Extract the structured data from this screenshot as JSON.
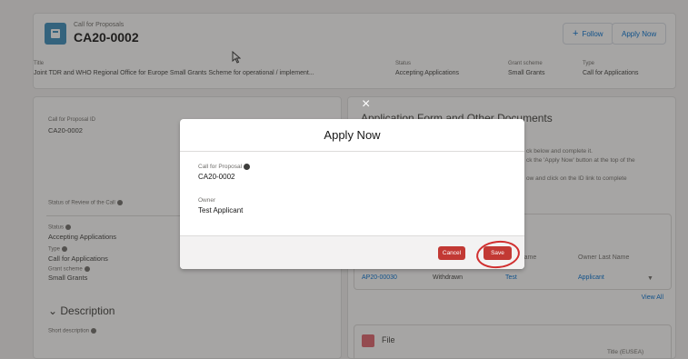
{
  "header": {
    "record_type": "Call for Proposals",
    "record_name": "CA20-0002",
    "follow_label": "Follow",
    "apply_label": "Apply Now",
    "fields": [
      {
        "label": "Title",
        "value": "Joint TDR and WHO Regional Office for Europe Small Grants Scheme for operational / implement..."
      },
      {
        "label": "Status",
        "value": "Accepting Applications"
      },
      {
        "label": "Grant scheme",
        "value": "Small Grants"
      },
      {
        "label": "Type",
        "value": "Call for Applications"
      }
    ]
  },
  "left_panel": {
    "call_id_label": "Call for Proposal ID",
    "call_id_value": "CA20-0002",
    "status_of_review_label": "Status of Review of the Call",
    "status_label": "Status",
    "status_value": "Accepting Applications",
    "type_label": "Type",
    "type_value": "Call for Applications",
    "grant_scheme_label": "Grant scheme",
    "grant_scheme_value": "Small Grants",
    "description_title": "Description",
    "short_description_label": "Short description"
  },
  "right_panel": {
    "title": "Application Form and Other Documents",
    "line1": "ck below and complete it.",
    "line2": "ck the 'Apply Now' button at the top of the",
    "line3": "ow and click on the ID link to complete",
    "table_headers": [
      "First Name",
      "Owner Last Name"
    ],
    "row": {
      "id": "AP20-00030",
      "status": "Withdrawn",
      "first_name": "Test",
      "last_name": "Applicant"
    },
    "view_all": "View All",
    "file_label": "File",
    "file_title": "Title (EUSEA)"
  },
  "modal": {
    "title": "Apply Now",
    "call_label": "Call for Proposal",
    "call_value": "CA20-0002",
    "owner_label": "Owner",
    "owner_value": "Test Applicant",
    "cancel_label": "Cancel",
    "save_label": "Save",
    "close_symbol": "×"
  },
  "colors": {
    "accent": "#c23934",
    "highlight": "#d12f2f",
    "link": "#0070d2"
  }
}
